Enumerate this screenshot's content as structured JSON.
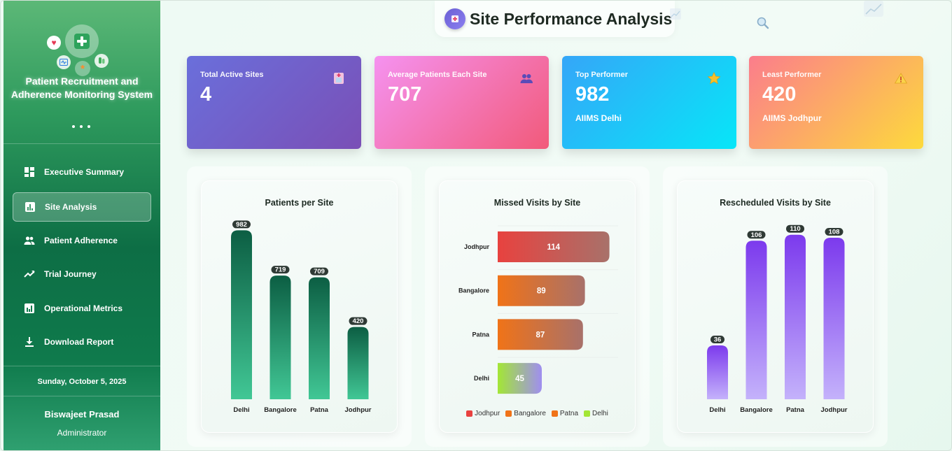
{
  "sidebar": {
    "app_title": "Patient Recruitment and Adherence Monitoring System",
    "nav": [
      {
        "label": "Executive Summary",
        "icon": "dashboard-icon",
        "active": false
      },
      {
        "label": "Site Analysis",
        "icon": "bar-chart-icon",
        "active": true
      },
      {
        "label": "Patient Adherence",
        "icon": "people-icon",
        "active": false
      },
      {
        "label": "Trial Journey",
        "icon": "trending-up-icon",
        "active": false
      },
      {
        "label": "Operational Metrics",
        "icon": "metrics-icon",
        "active": false
      },
      {
        "label": "Download Report",
        "icon": "download-icon",
        "active": false
      }
    ],
    "date": "Sunday, October 5, 2025",
    "user_name": "Biswajeet Prasad",
    "user_role": "Administrator"
  },
  "header": {
    "title": "Site Performance Analysis"
  },
  "kpis": [
    {
      "label": "Total Active Sites",
      "value": "4",
      "sub": "",
      "icon": "hospital-icon"
    },
    {
      "label": "Average Patients Each Site",
      "value": "707",
      "sub": "",
      "icon": "people-icon"
    },
    {
      "label": "Top Performer",
      "value": "982",
      "sub": "AIIMS Delhi",
      "icon": "star-icon"
    },
    {
      "label": "Least Performer",
      "value": "420",
      "sub": "AIIMS Jodhpur",
      "icon": "warning-icon"
    }
  ],
  "chart_data": [
    {
      "type": "bar",
      "title": "Patients per Site",
      "categories": [
        "Delhi",
        "Bangalore",
        "Patna",
        "Jodhpur"
      ],
      "values": [
        982,
        719,
        709,
        420
      ],
      "colors": {
        "top": "#0c5e43",
        "bottom": "#41c795"
      }
    },
    {
      "type": "bar",
      "orientation": "horizontal",
      "title": "Missed Visits by Site",
      "categories": [
        "Jodhpur",
        "Bangalore",
        "Patna",
        "Delhi"
      ],
      "values": [
        114,
        89,
        87,
        45
      ],
      "colors": [
        "#e8423f",
        "#f07318",
        "#f07318",
        "#a3e635"
      ],
      "legend": [
        "Jodhpur",
        "Bangalore",
        "Patna",
        "Delhi"
      ]
    },
    {
      "type": "bar",
      "title": "Rescheduled Visits by Site",
      "categories": [
        "Delhi",
        "Bangalore",
        "Patna",
        "Jodhpur"
      ],
      "values": [
        36,
        106,
        110,
        108
      ],
      "colors": {
        "top": "#7c3aed",
        "bottom": "#c4b2fb"
      }
    }
  ]
}
